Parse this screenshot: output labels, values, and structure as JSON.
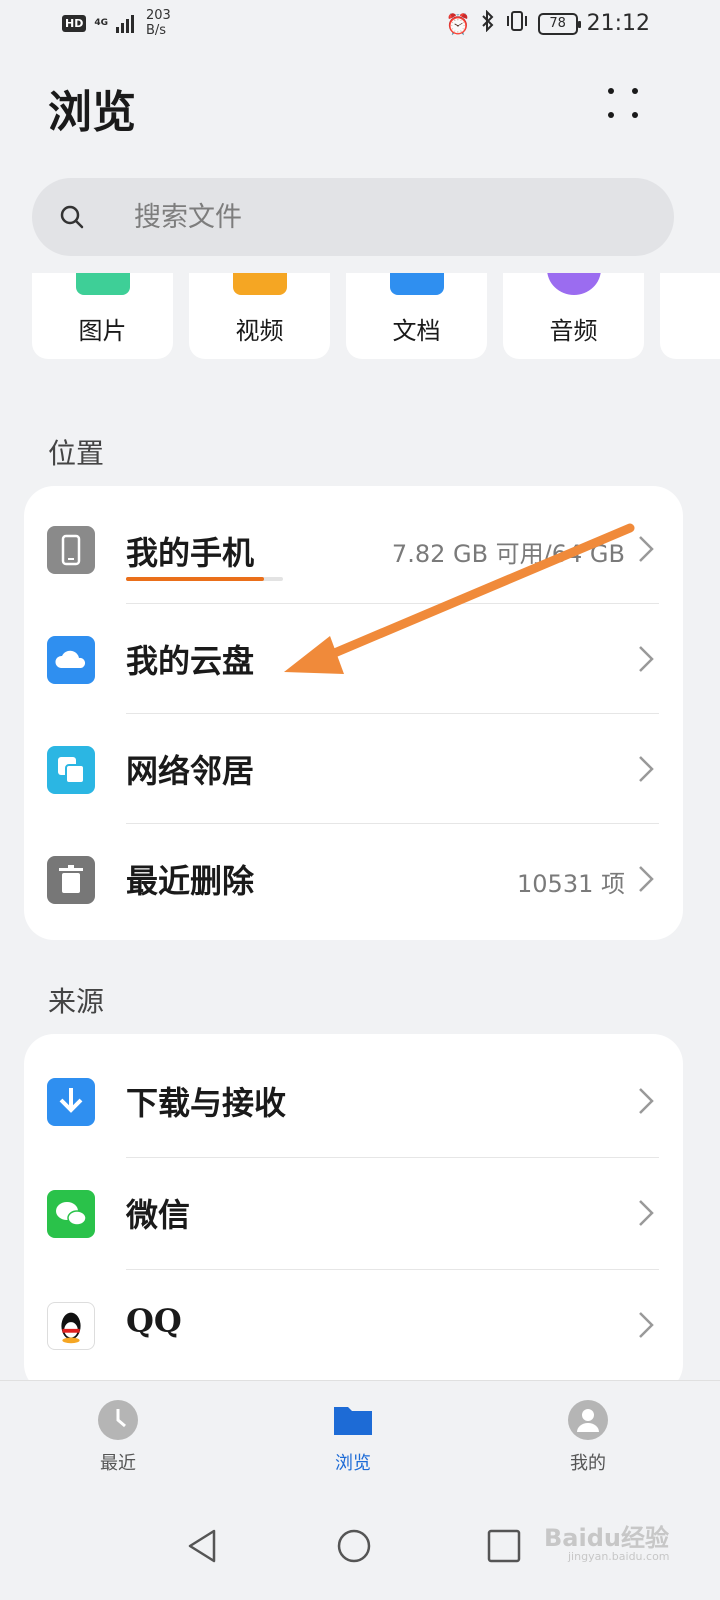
{
  "status_bar": {
    "hd": "HD",
    "network": "4G",
    "speed_value": "203",
    "speed_unit": "B/s",
    "battery": "78",
    "time": "21:12"
  },
  "header": {
    "title": "浏览"
  },
  "search": {
    "placeholder": "搜索文件"
  },
  "categories": [
    {
      "label": "图片",
      "color": "#3ecf97"
    },
    {
      "label": "视频",
      "color": "#f5a623"
    },
    {
      "label": "文档",
      "color": "#2f8ff0"
    },
    {
      "label": "音频",
      "color": "#9b6cf0"
    }
  ],
  "location": {
    "title": "位置",
    "items": [
      {
        "label": "我的手机",
        "meta": "7.82 GB 可用/64 GB",
        "icon": "phone-icon",
        "color": "#8a8a8a"
      },
      {
        "label": "我的云盘",
        "meta": "",
        "icon": "cloud-icon",
        "color": "#2f8ff0"
      },
      {
        "label": "网络邻居",
        "meta": "",
        "icon": "network-icon",
        "color": "#2bb6e3"
      },
      {
        "label": "最近删除",
        "meta": "10531 项",
        "icon": "trash-icon",
        "color": "#777777"
      }
    ],
    "storage_used_fraction": 0.88
  },
  "sources": {
    "title": "来源",
    "items": [
      {
        "label": "下载与接收",
        "icon": "download-icon",
        "color": "#2f8ff0"
      },
      {
        "label": "微信",
        "icon": "wechat-icon",
        "color": "#2ac24a"
      },
      {
        "label": "QQ",
        "icon": "qq-icon",
        "color": "#ffffff"
      }
    ]
  },
  "bottom_nav": [
    {
      "label": "最近",
      "icon": "clock-icon",
      "active": false
    },
    {
      "label": "浏览",
      "icon": "folder-icon",
      "active": true
    },
    {
      "label": "我的",
      "icon": "user-icon",
      "active": false
    }
  ],
  "watermark": {
    "text": "Baidu经验",
    "sub": "jingyan.baidu.com"
  },
  "accent_color": "#ea6f1a"
}
